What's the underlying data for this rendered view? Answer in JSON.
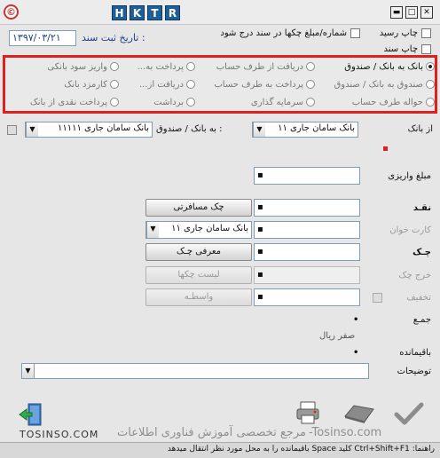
{
  "titlebar": {
    "hotkeys": [
      "H",
      "K",
      "T",
      "R"
    ],
    "min": "▬",
    "max": "□",
    "close": "✕"
  },
  "header": {
    "chk_amount_label": "شماره/مبلغ چکها در سند درج شود",
    "chk_print_receipt": "چاپ رسید",
    "chk_print_doc": "چاپ سند",
    "date_label": "تاریخ ثبت سند :",
    "date_value": "۱۳۹۷/۰۳/۲۱"
  },
  "options": {
    "row1": [
      "بانک به بانک / صندوق",
      "دریافت از طرف حساب",
      "پرداخت به...",
      "واریز سود بانکی"
    ],
    "row2": [
      "صندوق به بانک / صندوق",
      "پرداخت به طرف حساب",
      "دریافت از...",
      "کارمزد بانک"
    ],
    "row3": [
      "حواله طرف حساب",
      "سرمایه گذاری",
      "برداشت",
      "پرداخت نقدی از بانک"
    ]
  },
  "from_bank": {
    "label": "از بانک",
    "value": "بانک سامان جاری ۱۱"
  },
  "to_bank": {
    "label": "به بانک / صندوق :",
    "value": "بانک سامان جاری ۱۱۱۱۱"
  },
  "form": {
    "deposit_label": "مبلغ واریزی",
    "deposit_value": "",
    "cash_label": "نقـد",
    "travel_cheque_btn": "چک مسافرتی",
    "card_label": "کارت خوان",
    "card_bank_value": "بانک سامان جاری ۱۱",
    "cheque_label": "چـک",
    "introduce_cheque_btn": "معرفی چـک",
    "withdraw_cheque_label": "خرج چک",
    "list_cheques_btn": "لیست چکها",
    "discount_label": "تخفیف",
    "broker_btn": "واسطـه",
    "sum_label": "جمـع",
    "sum_value": "•",
    "rial_text": "صفر ریال",
    "remain_label": "باقیمانده",
    "remain_value": "•",
    "desc_label": "توضیحات"
  },
  "status": {
    "help_text": "راهنما: Ctrl+Shift+F1 کلید Space باقیمانده را به محل مورد نظر انتقال میدهد",
    "watermark_left": "TOSINSO.COM",
    "watermark_mid": "مرجع تخصصی آموزش فناوری اطلاعات",
    "watermark_right": "-Tosinso.com"
  },
  "colors": {
    "highlight_border": "#e0201f",
    "hotkey_bg": "#1f5f96"
  }
}
